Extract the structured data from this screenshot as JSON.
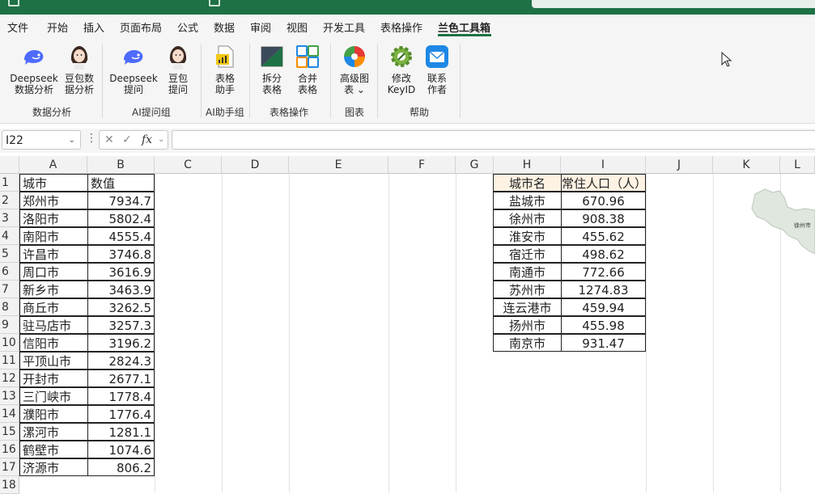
{
  "menu": {
    "items": [
      "文件",
      "开始",
      "插入",
      "页面布局",
      "公式",
      "数据",
      "审阅",
      "视图",
      "开发工具",
      "表格操作",
      "兰色工具箱"
    ],
    "active": "兰色工具箱"
  },
  "ribbon": {
    "buttons": [
      {
        "l1": "Deepseek",
        "l2": "数据分析",
        "icon": "whale-icon"
      },
      {
        "l1": "豆包数",
        "l2": "据分析",
        "icon": "avatar-icon"
      },
      {
        "l1": "Deepseek",
        "l2": "提问",
        "icon": "whale-icon"
      },
      {
        "l1": "豆包",
        "l2": "提问",
        "icon": "avatar-icon"
      },
      {
        "l1": "表格",
        "l2": "助手",
        "icon": "chart-doc-icon"
      },
      {
        "l1": "拆分",
        "l2": "表格",
        "icon": "split-table-icon"
      },
      {
        "l1": "合并",
        "l2": "表格",
        "icon": "merge-table-icon"
      },
      {
        "l1": "高级图",
        "l2": "表 ⌄",
        "icon": "pie-chart-icon"
      },
      {
        "l1": "修改",
        "l2": "KeyID",
        "icon": "gear-icon"
      },
      {
        "l1": "联系",
        "l2": "作者",
        "icon": "mail-icon"
      }
    ],
    "groups": [
      "数据分析",
      "AI提问组",
      "AI助手组",
      "表格操作",
      "图表",
      "帮助"
    ]
  },
  "formula_bar": {
    "name_box": "I22",
    "fx": "fx",
    "formula": ""
  },
  "columns": [
    "A",
    "B",
    "C",
    "D",
    "E",
    "F",
    "G",
    "H",
    "I",
    "J",
    "K",
    "L"
  ],
  "rows": [
    "1",
    "2",
    "3",
    "4",
    "5",
    "6",
    "7",
    "8",
    "9",
    "10",
    "11",
    "12",
    "13",
    "14",
    "15",
    "16",
    "17",
    "18"
  ],
  "table1": {
    "header": [
      "城市",
      "数值"
    ],
    "rows": [
      [
        "郑州市",
        "7934.7"
      ],
      [
        "洛阳市",
        "5802.4"
      ],
      [
        "南阳市",
        "4555.4"
      ],
      [
        "许昌市",
        "3746.8"
      ],
      [
        "周口市",
        "3616.9"
      ],
      [
        "新乡市",
        "3463.9"
      ],
      [
        "商丘市",
        "3262.5"
      ],
      [
        "驻马店市",
        "3257.3"
      ],
      [
        "信阳市",
        "3196.2"
      ],
      [
        "平顶山市",
        "2824.3"
      ],
      [
        "开封市",
        "2677.1"
      ],
      [
        "三门峡市",
        "1778.4"
      ],
      [
        "濮阳市",
        "1776.4"
      ],
      [
        "漯河市",
        "1281.1"
      ],
      [
        "鹤壁市",
        "1074.6"
      ],
      [
        "济源市",
        "806.2"
      ]
    ]
  },
  "table2": {
    "header": [
      "城市名",
      "常住人口（人）"
    ],
    "rows": [
      [
        "盐城市",
        "670.96"
      ],
      [
        "徐州市",
        "908.38"
      ],
      [
        "淮安市",
        "455.62"
      ],
      [
        "宿迁市",
        "498.62"
      ],
      [
        "南通市",
        "772.66"
      ],
      [
        "苏州市",
        "1274.83"
      ],
      [
        "连云港市",
        "459.94"
      ],
      [
        "扬州市",
        "455.98"
      ],
      [
        "南京市",
        "931.47"
      ]
    ]
  },
  "map": {
    "label": "徐州市"
  },
  "colors": {
    "accent": "#1e7145",
    "header_fill": "#fdf2e3"
  }
}
